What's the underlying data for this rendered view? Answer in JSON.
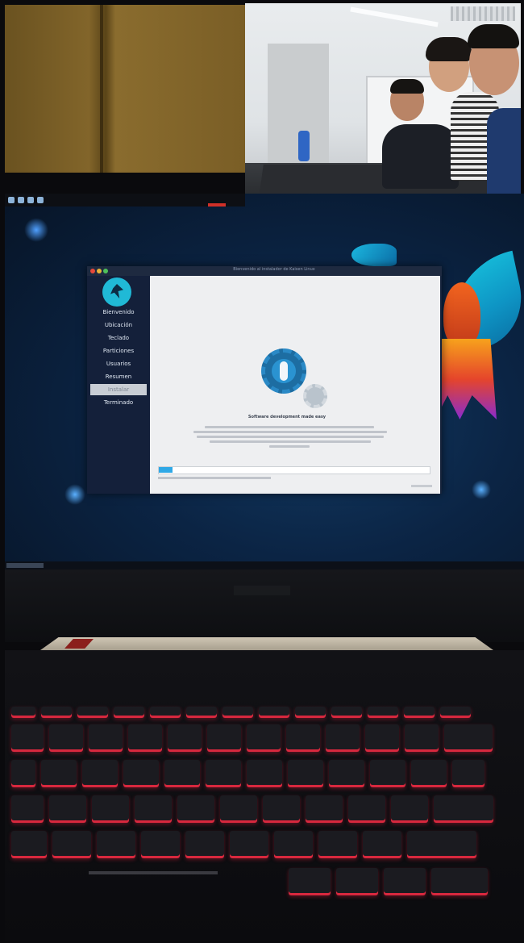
{
  "installer": {
    "window_title": "Bienvenido al instalador de Kaisen Linux",
    "sidebar": {
      "items": [
        {
          "label": "Bienvenido"
        },
        {
          "label": "Ubicación"
        },
        {
          "label": "Teclado"
        },
        {
          "label": "Particiones"
        },
        {
          "label": "Usuarios"
        },
        {
          "label": "Resumen"
        },
        {
          "label": "Instalar"
        },
        {
          "label": "Terminado"
        }
      ],
      "active_index": 6
    },
    "content": {
      "headline": "Software development made easy",
      "progress": 0.05
    }
  },
  "colors": {
    "accent": "#2fa8e6",
    "logo": "#20b9d6",
    "keyboard_backlight": "#d8283e"
  },
  "icons": [
    "installer-logo-icon",
    "settings-gear-icon",
    "wrench-icon"
  ]
}
